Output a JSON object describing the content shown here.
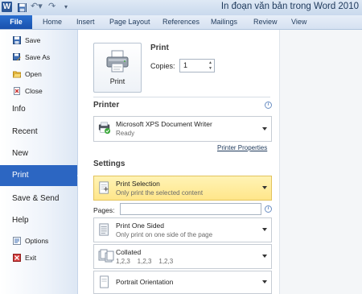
{
  "window": {
    "title": "In đoạn văn bản trong Word 2010"
  },
  "quick_access": {
    "app_logo": "W",
    "undo_icon": "undo-icon",
    "redo_icon": "redo-icon"
  },
  "ribbon_tabs": {
    "file": "File",
    "home": "Home",
    "insert": "Insert",
    "page_layout": "Page Layout",
    "references": "References",
    "mailings": "Mailings",
    "review": "Review",
    "view": "View"
  },
  "nav": {
    "save": "Save",
    "save_as": "Save As",
    "open": "Open",
    "close": "Close",
    "info": "Info",
    "recent": "Recent",
    "new": "New",
    "print": "Print",
    "save_send": "Save & Send",
    "help": "Help",
    "options": "Options",
    "exit": "Exit"
  },
  "print_panel": {
    "section_title": "Print",
    "print_button": "Print",
    "copies_label": "Copies:",
    "copies_value": "1",
    "printer_title": "Printer",
    "printer_name": "Microsoft XPS Document Writer",
    "printer_status": "Ready",
    "printer_properties": "Printer Properties",
    "settings_title": "Settings",
    "pages_label": "Pages:",
    "settings": {
      "selection_title": "Print Selection",
      "selection_desc": "Only print the selected content",
      "sided_title": "Print One Sided",
      "sided_desc": "Only print on one side of the page",
      "collated_title": "Collated",
      "collated_desc": "1,2,3    1,2,3    1,2,3",
      "orientation_title": "Portrait Orientation"
    }
  },
  "colors": {
    "accent_blue": "#2c66c2",
    "file_tab": "#1951ad",
    "selection_highlight": "#ffe68a"
  }
}
